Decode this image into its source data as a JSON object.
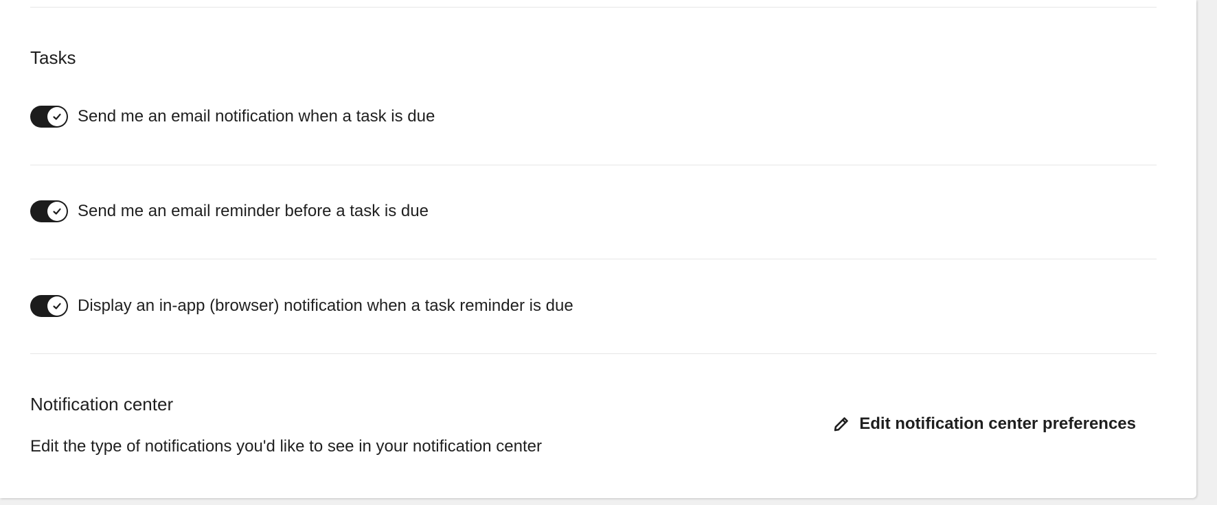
{
  "tasks": {
    "title": "Tasks",
    "toggles": [
      {
        "label": "Send me an email notification when a task is due",
        "enabled": true
      },
      {
        "label": "Send me an email reminder before a task is due",
        "enabled": true
      },
      {
        "label": "Display an in-app (browser) notification when a task reminder is due",
        "enabled": true
      }
    ]
  },
  "notification_center": {
    "title": "Notification center",
    "description": "Edit the type of notifications you'd like to see in your notification center",
    "edit_label": "Edit notification center preferences",
    "edit_icon": "pencil-icon"
  },
  "colors": {
    "toggle_on": "#1c1c1c",
    "divider": "#e6e6e6",
    "text": "#1f1f1f"
  }
}
